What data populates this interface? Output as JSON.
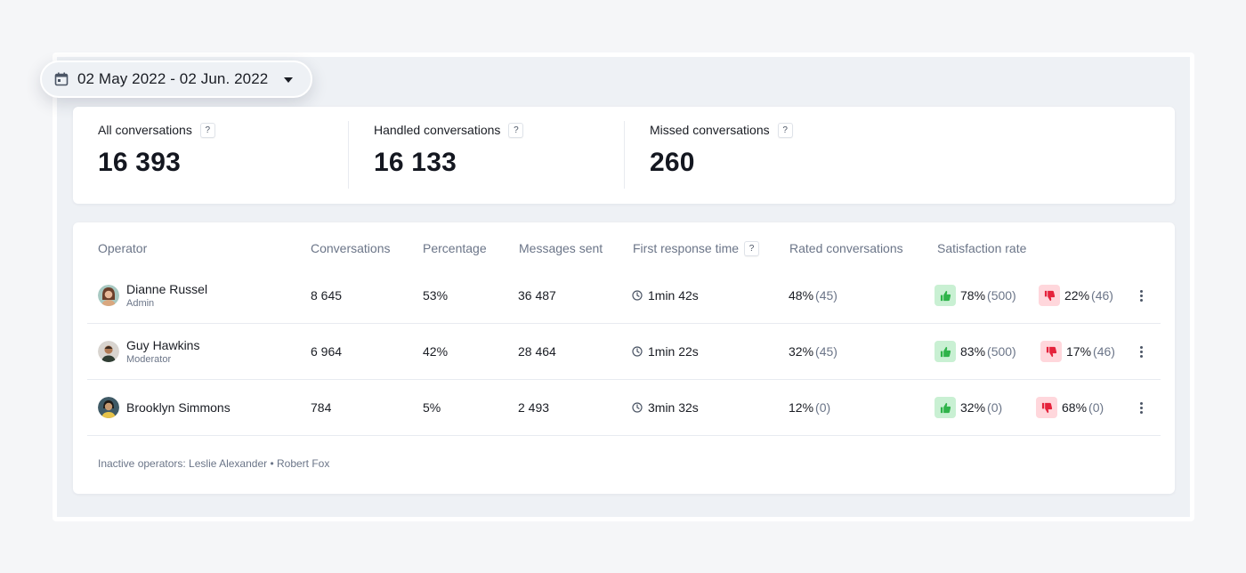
{
  "date_range": {
    "label": "02 May 2022 - 02 Jun. 2022",
    "icon": "calendar-icon"
  },
  "stats": [
    {
      "label": "All conversations",
      "help": "?",
      "value": "16 393"
    },
    {
      "label": "Handled conversations",
      "help": "?",
      "value": "16 133"
    },
    {
      "label": "Missed conversations",
      "help": "?",
      "value": "260"
    }
  ],
  "table": {
    "headers": {
      "operator": "Operator",
      "conversations": "Conversations",
      "percentage": "Percentage",
      "messages_sent": "Messages sent",
      "first_response_time": "First response time",
      "first_response_help": "?",
      "rated_conversations": "Rated conversations",
      "satisfaction_rate": "Satisfaction rate"
    },
    "rows": [
      {
        "name": "Dianne Russel",
        "role": "Admin",
        "conversations": "8 645",
        "percentage": "53%",
        "messages_sent": "36 487",
        "first_response_time": "1min 42s",
        "rated_pct": "48%",
        "rated_count": "(45)",
        "positive_pct": "78%",
        "positive_count": "(500)",
        "negative_pct": "22%",
        "negative_count": "(46)"
      },
      {
        "name": "Guy Hawkins",
        "role": "Moderator",
        "conversations": "6 964",
        "percentage": "42%",
        "messages_sent": "28 464",
        "first_response_time": "1min 22s",
        "rated_pct": "32%",
        "rated_count": "(45)",
        "positive_pct": "83%",
        "positive_count": "(500)",
        "negative_pct": "17%",
        "negative_count": "(46)"
      },
      {
        "name": "Brooklyn Simmons",
        "role": "",
        "conversations": "784",
        "percentage": "5%",
        "messages_sent": "2 493",
        "first_response_time": "3min 32s",
        "rated_pct": "12%",
        "rated_count": "(0)",
        "positive_pct": "32%",
        "positive_count": "(0)",
        "negative_pct": "68%",
        "negative_count": "(0)"
      }
    ],
    "footer": "Inactive operators: Leslie Alexander • Robert Fox"
  },
  "colors": {
    "background": "#f5f6f8",
    "panel": "#eef1f5",
    "positive_bg": "#c9f0d3",
    "positive_icon": "#2fb34a",
    "negative_bg": "#ffd7dc",
    "negative_icon": "#e5233c",
    "muted_text": "#6b7588"
  }
}
